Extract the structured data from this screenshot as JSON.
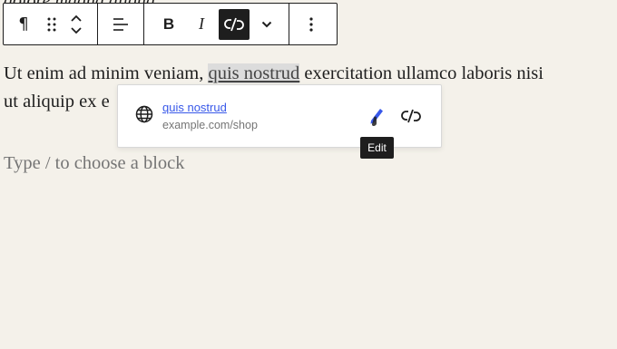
{
  "previous_block": {
    "text": "dolore magna aliqua."
  },
  "toolbar": {
    "paragraph_icon": "¶",
    "bold_label": "B",
    "italic_label": "I"
  },
  "paragraph": {
    "before": "Ut enim ad minim veniam, ",
    "link_text": "quis nostrud",
    "after_line1": " exercitation ullamco laboris nisi",
    "line2_visible": "ut aliquip ex e"
  },
  "link_popover": {
    "title": "quis nostrud",
    "url": "example.com/shop",
    "link_color": "#3858e9"
  },
  "tooltip": {
    "label": "Edit"
  },
  "placeholder": {
    "text": "Type / to choose a block"
  }
}
